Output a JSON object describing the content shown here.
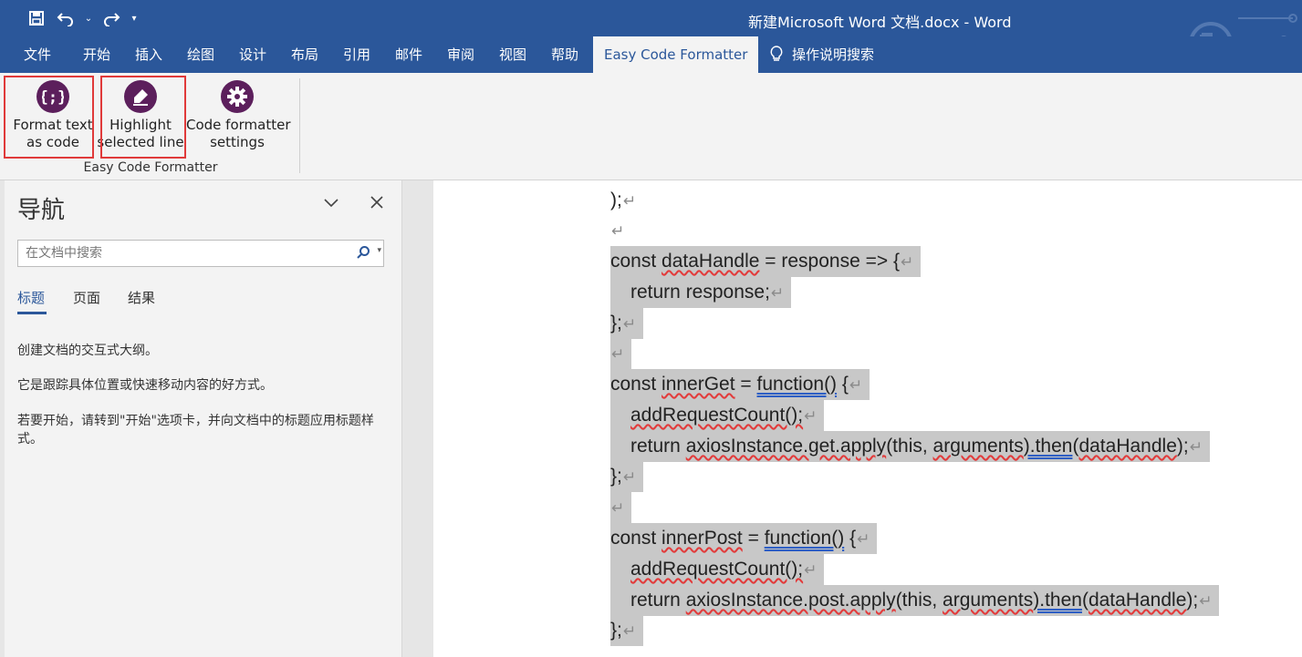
{
  "window": {
    "title": "新建Microsoft Word 文档.docx  -  Word",
    "quick_access": [
      {
        "name": "save-icon",
        "symbol": "💾"
      },
      {
        "name": "undo-icon",
        "symbol": "↶"
      },
      {
        "name": "redo-icon",
        "symbol": "↷"
      }
    ]
  },
  "ribbon_tabs": [
    "文件",
    "开始",
    "插入",
    "绘图",
    "设计",
    "布局",
    "引用",
    "邮件",
    "审阅",
    "视图",
    "帮助",
    "Easy Code Formatter"
  ],
  "active_tab": "Easy Code Formatter",
  "tell_me": "操作说明搜索",
  "ribbon_group": {
    "label": "Easy Code Formatter",
    "buttons": [
      {
        "line1": "Format text",
        "line2": "as code"
      },
      {
        "line1": "Highlight",
        "line2": "selected line"
      },
      {
        "line1": "Code formatter",
        "line2": "settings"
      }
    ]
  },
  "navigation": {
    "title": "导航",
    "search_placeholder": "在文档中搜索",
    "tabs": [
      "标题",
      "页面",
      "结果"
    ],
    "active_tab": "标题",
    "paragraphs": [
      "创建文档的交互式大纲。",
      "它是跟踪具体位置或快速移动内容的好方式。",
      "若要开始，请转到\"开始\"选项卡，并向文档中的标题应用标题样式。"
    ]
  },
  "document": {
    "paragraph_mark": "↵",
    "lines": [
      {
        "text": ");",
        "highlight": false
      },
      {
        "text": "",
        "highlight": false
      },
      {
        "text": "const dataHandle = response => {",
        "highlight": true
      },
      {
        "text": "return response;",
        "highlight": true,
        "indent": true
      },
      {
        "text": "};",
        "highlight": true
      },
      {
        "text": "",
        "highlight": true
      },
      {
        "text": "const innerGet = function() {",
        "highlight": true
      },
      {
        "text": "addRequestCount();",
        "highlight": true,
        "indent": true
      },
      {
        "text": "return axiosInstance.get.apply(this, arguments).then(dataHandle);",
        "highlight": true,
        "indent": true
      },
      {
        "text": "};",
        "highlight": true
      },
      {
        "text": "",
        "highlight": true
      },
      {
        "text": "const innerPost = function() {",
        "highlight": true
      },
      {
        "text": "addRequestCount();",
        "highlight": true,
        "indent": true
      },
      {
        "text": "return axiosInstance.post.apply(this, arguments).then(dataHandle);",
        "highlight": true,
        "indent": true
      },
      {
        "text": "};",
        "highlight": true
      }
    ]
  },
  "colors": {
    "word_blue": "#2b579a",
    "addin_purple": "#5c1f5c",
    "callout_red": "#e03a3a",
    "selection_gray": "#c8c8c8"
  }
}
